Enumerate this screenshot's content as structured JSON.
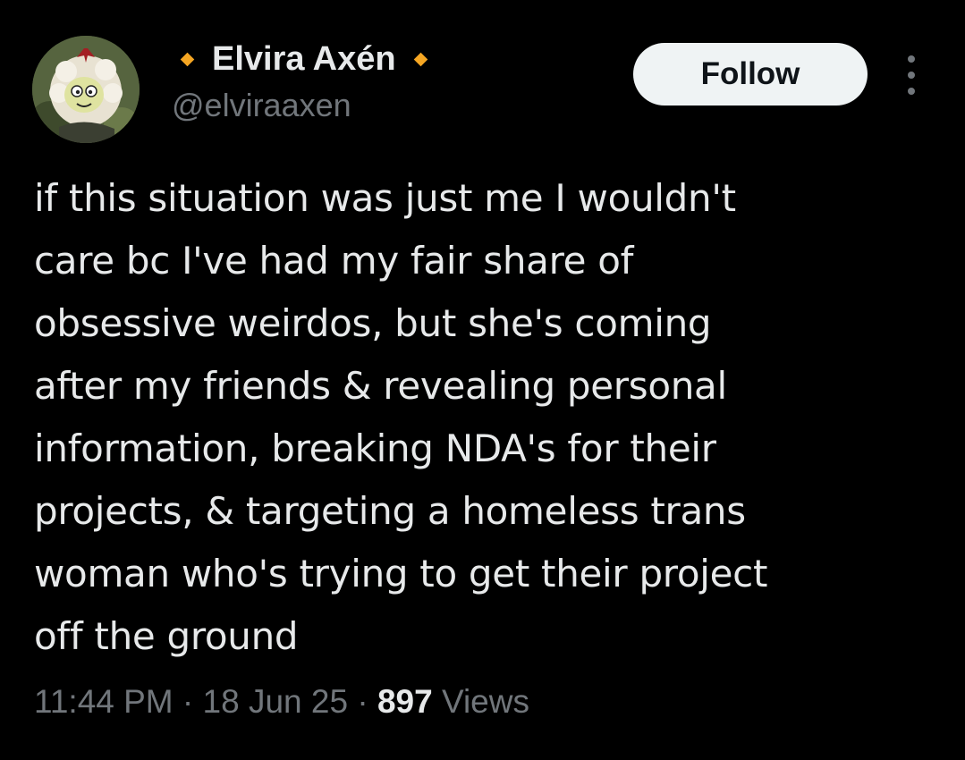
{
  "author": {
    "display_name": "Elvira Axén",
    "handle": "@elviraaxen",
    "badge_icon": "orange-diamond-icon",
    "badge_color": "#f5a623"
  },
  "actions": {
    "follow_label": "Follow",
    "more_icon": "more-options-icon"
  },
  "tweet": {
    "lines": [
      "if this situation was just me I wouldn't",
      "care bc I've had my fair share of",
      "obsessive weirdos, but she's coming",
      "after my friends & revealing personal",
      "information, breaking NDA's for their",
      "projects, & targeting a homeless trans",
      "woman who's trying to get their project",
      "off the ground"
    ]
  },
  "meta": {
    "time": "11:44 PM",
    "separator": " · ",
    "date": "18 Jun 25",
    "views_count": "897",
    "views_label": "Views"
  },
  "colors": {
    "background": "#000000",
    "text_primary": "#e7e9ea",
    "text_secondary": "#71767b",
    "follow_bg": "#eff3f4"
  }
}
